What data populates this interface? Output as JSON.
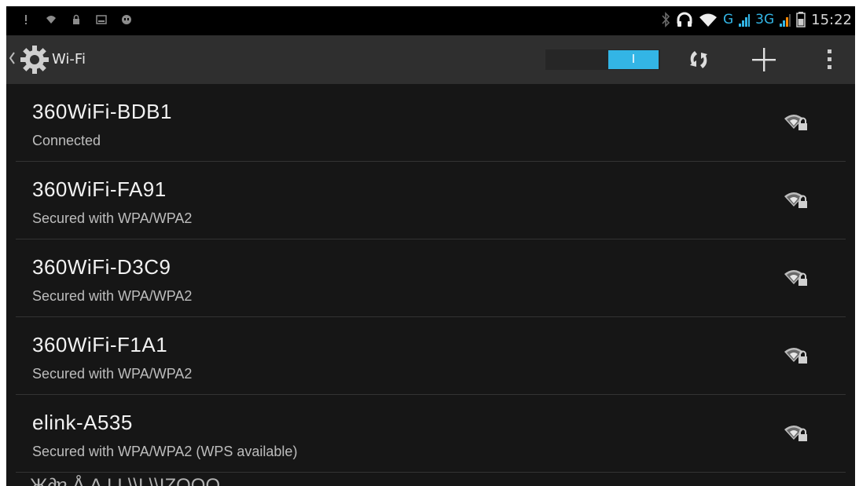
{
  "status_bar": {
    "left_icons": [
      "notification-icon",
      "wifi-small-icon",
      "lock-icon",
      "image-icon",
      "android-debug-icon"
    ],
    "right_icons": [
      "bluetooth-icon",
      "headphones-icon",
      "wifi-icon",
      "signal-icon",
      "signal-icon",
      "battery-icon"
    ],
    "network_g": "G",
    "network_3g": "3G",
    "time": "15:22",
    "accent_color": "#33b5e5"
  },
  "action_bar": {
    "title": "Wi-Fi",
    "toggle_label": "I",
    "toggle_state": "on",
    "actions": [
      "refresh-icon",
      "add-network-icon",
      "overflow-menu-icon"
    ]
  },
  "networks": [
    {
      "name": "360WiFi-BDB1",
      "status": "Connected",
      "icon": "wifi-secured-icon"
    },
    {
      "name": "360WiFi-FA91",
      "status": "Secured with WPA/WPA2",
      "icon": "wifi-secured-icon"
    },
    {
      "name": "360WiFi-D3C9",
      "status": "Secured with WPA/WPA2",
      "icon": "wifi-secured-icon"
    },
    {
      "name": "360WiFi-F1A1",
      "status": "Secured with WPA/WPA2",
      "icon": "wifi-secured-icon"
    },
    {
      "name": "elink-A535",
      "status": "Secured with WPA/WPA2 (WPS available)",
      "icon": "wifi-secured-icon"
    }
  ],
  "partial_row_text": "Ж∂ɐ Å ∆ LL\\\\L\\\\IZOOO"
}
